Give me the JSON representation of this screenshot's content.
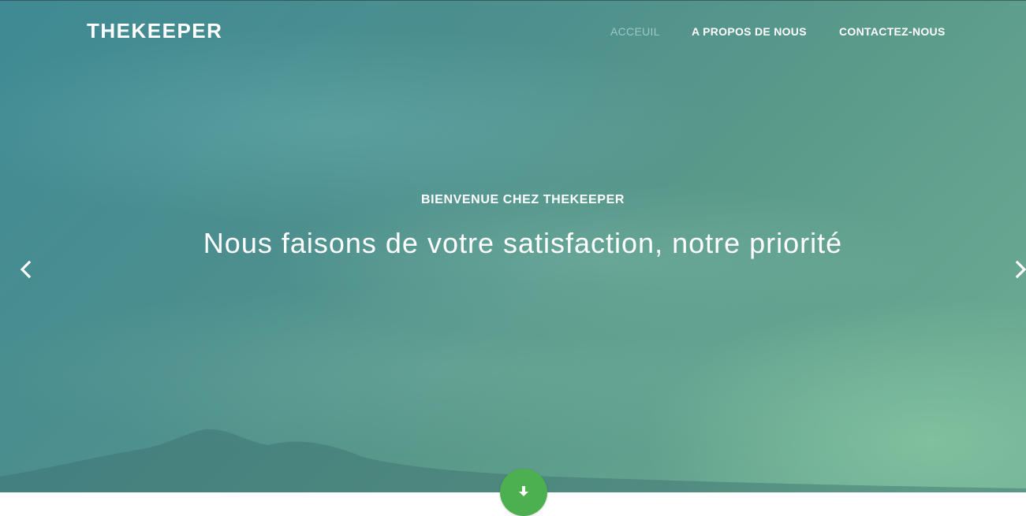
{
  "header": {
    "brand": "THEKEEPER",
    "nav": [
      {
        "label": "ACCEUIL",
        "active": true
      },
      {
        "label": "A PROPOS DE NOUS",
        "active": false
      },
      {
        "label": "CONTACTEZ-NOUS",
        "active": false
      }
    ]
  },
  "hero": {
    "subtitle": "BIENVENUE CHEZ THEKEEPER",
    "title": "Nous faisons de votre satisfaction, notre priorité",
    "prev_icon": "chevron-left-icon",
    "next_icon": "chevron-right-icon"
  },
  "scroll_button": {
    "icon": "arrow-down-icon",
    "color": "#4caf50"
  }
}
